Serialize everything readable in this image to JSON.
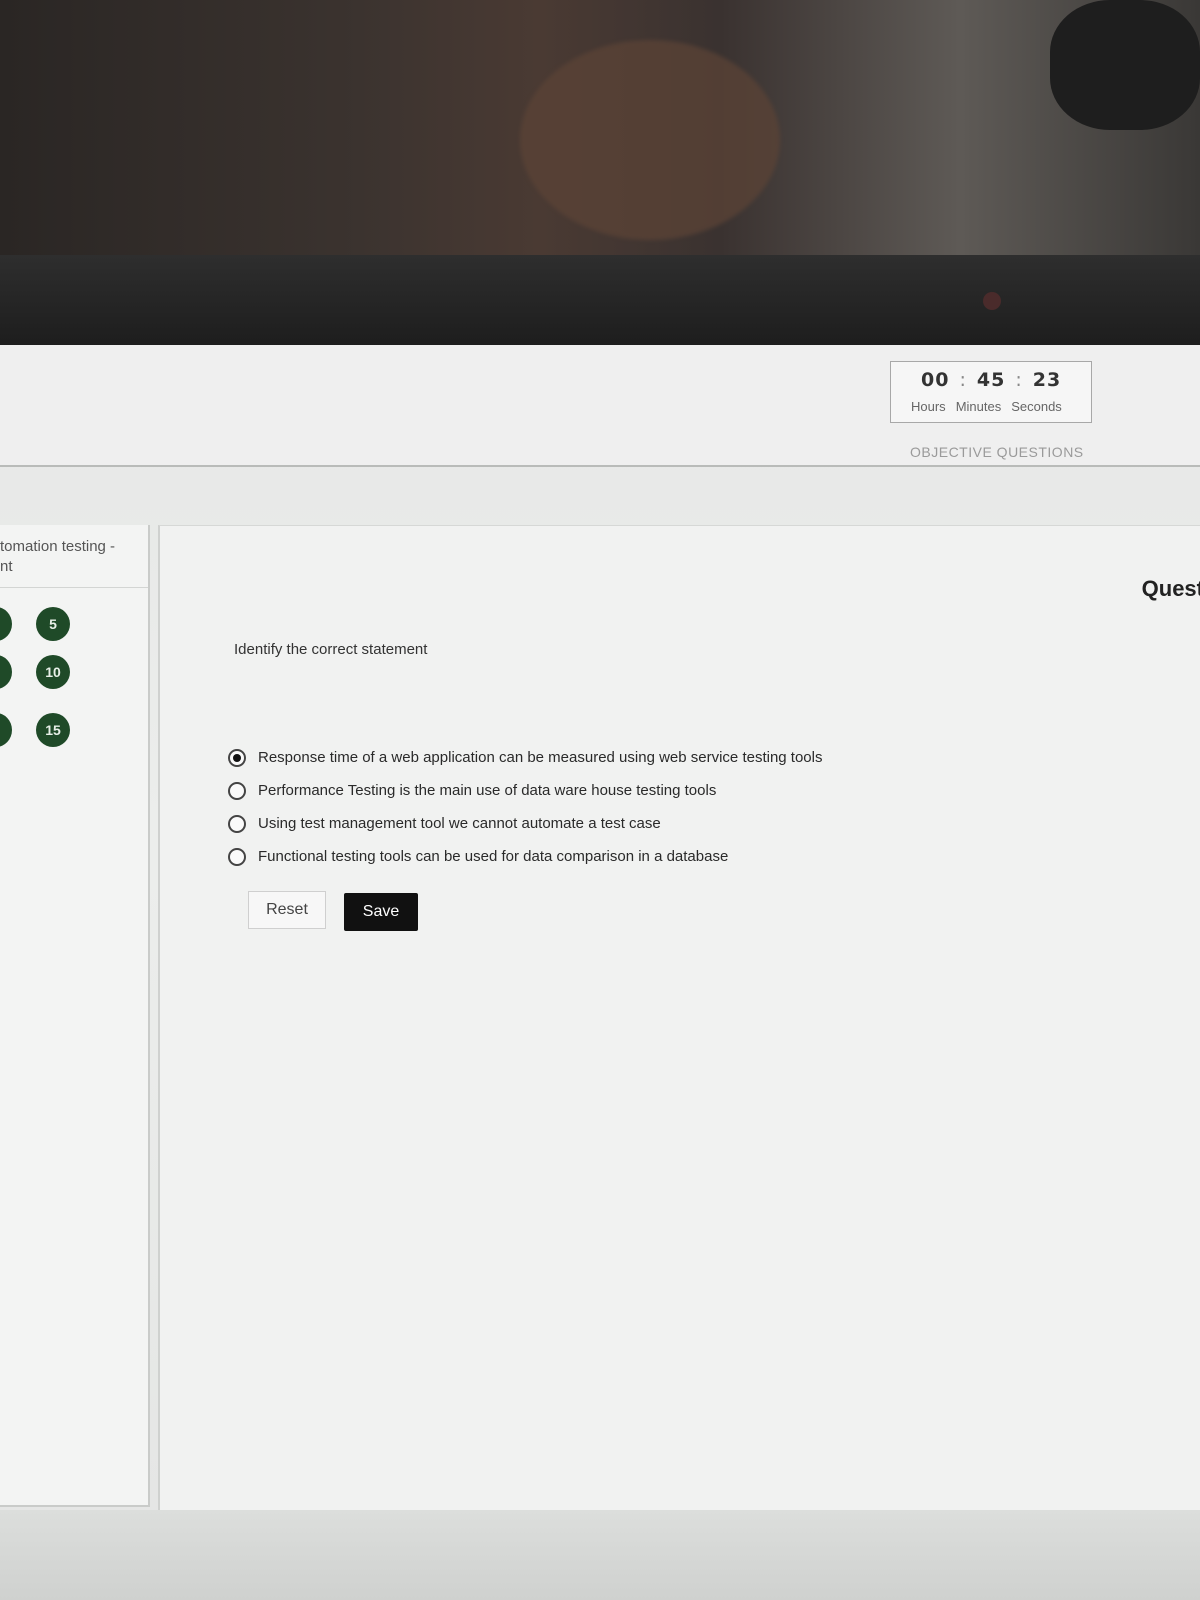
{
  "timer": {
    "hours": "00",
    "minutes": "45",
    "seconds": "23",
    "label_hours": "Hours",
    "label_minutes": "Minutes",
    "label_seconds": "Seconds"
  },
  "section_title": "OBJECTIVE QUESTIONS",
  "sidebar": {
    "title_line1": "tomation testing -",
    "title_line2": "nt",
    "question_numbers": [
      "5",
      "10",
      "15"
    ]
  },
  "question": {
    "header": "Quest",
    "text": "Identify the correct statement",
    "options": [
      "Response time of a web application can be measured using web service testing tools",
      "Performance Testing is the main use of data ware house testing tools",
      "Using test management tool we cannot automate a test case",
      "Functional testing tools can be used for data comparison in a database"
    ],
    "selected_index": 0
  },
  "buttons": {
    "reset": "Reset",
    "save": "Save"
  }
}
